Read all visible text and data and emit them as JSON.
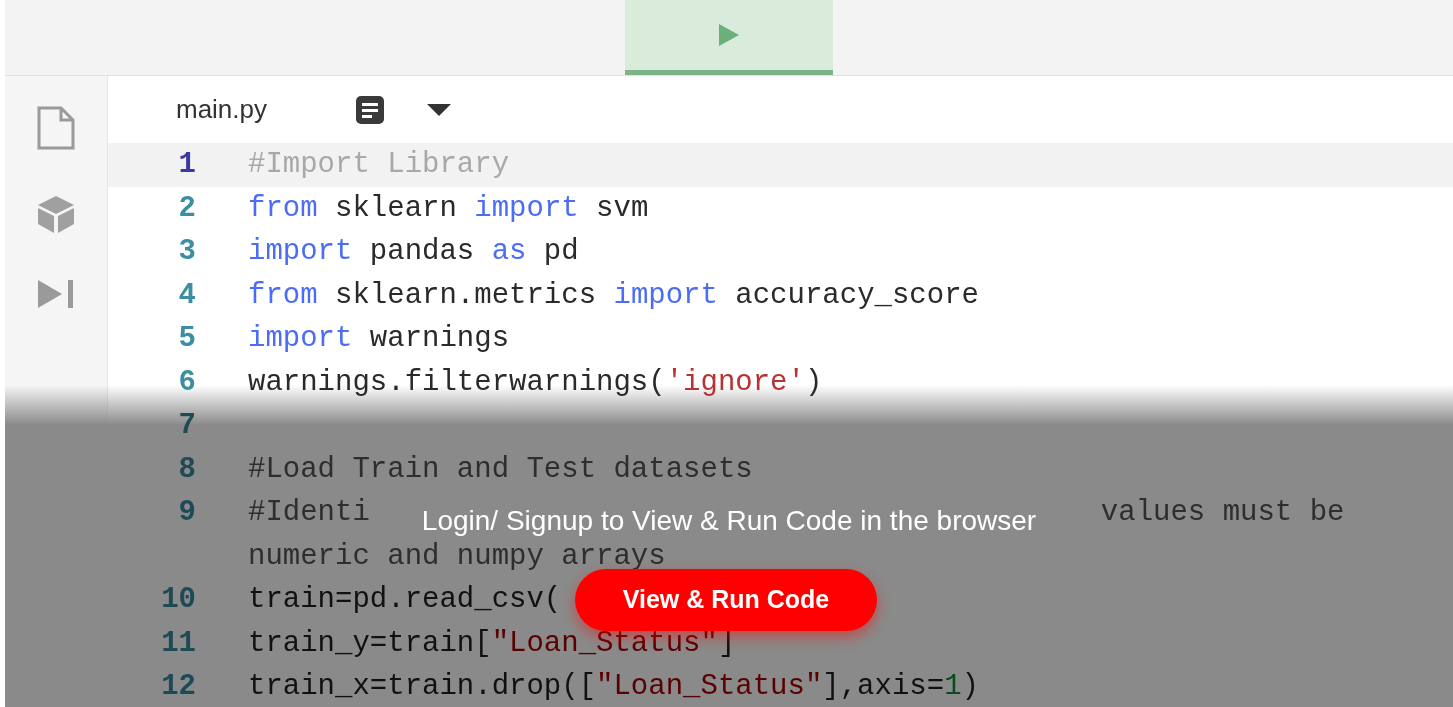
{
  "toolbar": {
    "run_button": {
      "selected": true
    }
  },
  "tabs": [
    {
      "label": "main.py",
      "selected": true
    }
  ],
  "editor": {
    "lines": [
      {
        "number": "1",
        "current": true,
        "tokens": [
          {
            "kind": "comment",
            "text": "#Import Library"
          }
        ]
      },
      {
        "number": "2",
        "current": false,
        "tokens": [
          {
            "kind": "keyword",
            "text": "from"
          },
          {
            "kind": "plain",
            "text": " sklearn "
          },
          {
            "kind": "keyword",
            "text": "import"
          },
          {
            "kind": "plain",
            "text": " svm"
          }
        ]
      },
      {
        "number": "3",
        "current": false,
        "tokens": [
          {
            "kind": "keyword",
            "text": "import"
          },
          {
            "kind": "plain",
            "text": " pandas "
          },
          {
            "kind": "keyword",
            "text": "as"
          },
          {
            "kind": "plain",
            "text": " pd"
          }
        ]
      },
      {
        "number": "4",
        "current": false,
        "tokens": [
          {
            "kind": "keyword",
            "text": "from"
          },
          {
            "kind": "plain",
            "text": " sklearn.metrics "
          },
          {
            "kind": "keyword",
            "text": "import"
          },
          {
            "kind": "plain",
            "text": " accuracy_score"
          }
        ]
      },
      {
        "number": "5",
        "current": false,
        "tokens": [
          {
            "kind": "keyword",
            "text": "import"
          },
          {
            "kind": "plain",
            "text": " warnings"
          }
        ]
      },
      {
        "number": "6",
        "current": false,
        "tokens": [
          {
            "kind": "plain",
            "text": "warnings.filterwarnings("
          },
          {
            "kind": "string",
            "text": "'ignore'"
          },
          {
            "kind": "plain",
            "text": ")"
          }
        ]
      },
      {
        "number": "7",
        "current": false
      },
      {
        "number": "8",
        "current": false,
        "tokens": [
          {
            "kind": "comment",
            "text": "#Load Train and Test datasets"
          }
        ]
      },
      {
        "number": "9",
        "current": false,
        "tokens": [
          {
            "kind": "comment",
            "text": "#Identi"
          },
          {
            "kind": "comment",
            "text": "values must be",
            "gap": true
          }
        ]
      },
      {
        "current": false,
        "tokens": [
          {
            "kind": "comment",
            "text": "numeric and numpy arrays"
          }
        ]
      },
      {
        "number": "10",
        "current": false,
        "tokens": [
          {
            "kind": "plain",
            "text": "train=pd.read_csv("
          }
        ]
      },
      {
        "number": "11",
        "current": false,
        "tokens": [
          {
            "kind": "plain",
            "text": "train_y=train["
          },
          {
            "kind": "string",
            "text": "\"Loan_Status\""
          },
          {
            "kind": "plain",
            "text": "]"
          }
        ]
      },
      {
        "number": "12",
        "current": false,
        "tokens": [
          {
            "kind": "plain",
            "text": "train_x=train.drop(["
          },
          {
            "kind": "string",
            "text": "\"Loan_Status\""
          },
          {
            "kind": "plain",
            "text": "],axis="
          },
          {
            "kind": "number",
            "text": "1"
          },
          {
            "kind": "plain",
            "text": ")"
          }
        ]
      }
    ]
  },
  "overlay": {
    "message": "Login/ Signup to View & Run Code in the browser",
    "button": "View & Run Code"
  }
}
